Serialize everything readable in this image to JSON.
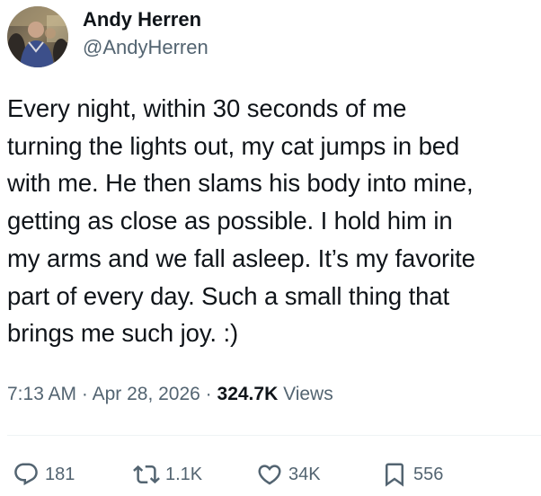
{
  "author": {
    "display_name": "Andy Herren",
    "handle": "@AndyHerren"
  },
  "tweet": {
    "text": "Every night, within 30 seconds of me\nturning the lights out, my cat jumps in bed\nwith me. He then slams his body into mine,\ngetting as close as possible. I hold him in\nmy arms and we fall asleep. It’s my favorite\npart of every day. Such a small thing that\nbrings me such joy. :)",
    "time": "7:13 AM",
    "separator1": " · ",
    "date": "Apr 28, 2026",
    "separator2": " · ",
    "views_count": "324.7K",
    "views_label": " Views"
  },
  "actions": {
    "replies": "181",
    "reposts": "1.1K",
    "likes": "34K",
    "bookmarks": "556"
  },
  "icons": {
    "reply": "reply-icon",
    "repost": "repost-icon",
    "like": "heart-icon",
    "bookmark": "bookmark-icon"
  },
  "colors": {
    "text": "#0f1419",
    "secondary": "#536471",
    "divider": "#eff3f4"
  }
}
